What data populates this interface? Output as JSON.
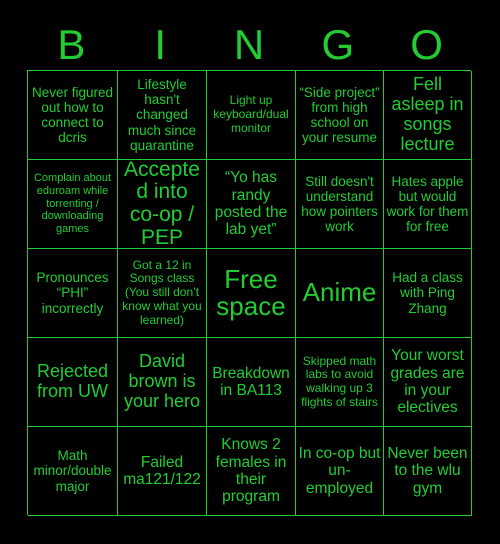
{
  "card": {
    "header_letters": [
      "B",
      "I",
      "N",
      "G",
      "O"
    ],
    "colors": {
      "background": "#000000",
      "accent": "#22CC33",
      "border": "#22CC33",
      "text": "#22CC33"
    },
    "rows": [
      [
        {
          "text": "Never figured out how to connect to dcris",
          "size": "md"
        },
        {
          "text": "Lifestyle hasn't changed much since quarantine",
          "size": "md"
        },
        {
          "text": "Light up keyboard/dual monitor",
          "size": "sm"
        },
        {
          "text": "“Side project” from high school on your resume",
          "size": "md"
        },
        {
          "text": "Fell asleep in songs lecture",
          "size": "xl"
        }
      ],
      [
        {
          "text": "Complain about eduroam while torrenting / downloading games",
          "size": "xs"
        },
        {
          "text": "Accepted into co-op / PEP",
          "size": "2xl"
        },
        {
          "text": "“Yo has randy posted the lab yet”",
          "size": "lg"
        },
        {
          "text": "Still doesn't understand how pointers work",
          "size": "md"
        },
        {
          "text": "Hates apple but would work for them for free",
          "size": "md"
        }
      ],
      [
        {
          "text": "Pronounces “PHI” incorrectly",
          "size": "md"
        },
        {
          "text": "Got a 12 in Songs class (You still don’t know what you learned)",
          "size": "sm"
        },
        {
          "text": "Free space",
          "size": "3xl"
        },
        {
          "text": "Anime",
          "size": "3xl"
        },
        {
          "text": "Had a class with Ping Zhang",
          "size": "md"
        }
      ],
      [
        {
          "text": "Rejected from UW",
          "size": "xl"
        },
        {
          "text": "David brown is your hero",
          "size": "xl"
        },
        {
          "text": "Breakdown in BA113",
          "size": "lg"
        },
        {
          "text": "Skipped math labs to avoid walking up 3 flights of stairs",
          "size": "sm"
        },
        {
          "text": "Your worst grades are in your electives",
          "size": "lg"
        }
      ],
      [
        {
          "text": "Math minor/double major",
          "size": "md"
        },
        {
          "text": "Failed ma121/122",
          "size": "lg"
        },
        {
          "text": "Knows 2 females in their program",
          "size": "lg"
        },
        {
          "text": "In co-op but un-employed",
          "size": "lg"
        },
        {
          "text": "Never been to the wlu gym",
          "size": "lg"
        }
      ]
    ]
  }
}
